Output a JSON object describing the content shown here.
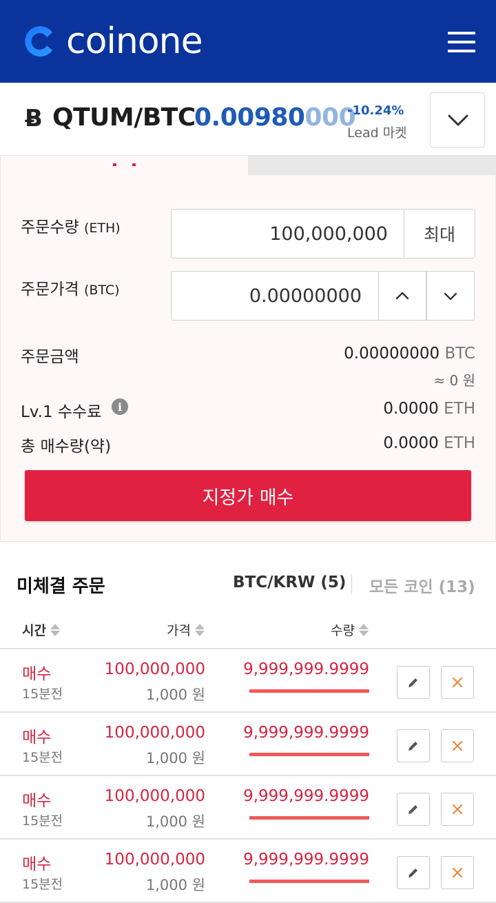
{
  "header": {
    "logo_text": "coinone",
    "brand_color": "#0a339c"
  },
  "market": {
    "coin_symbol": "Ƀ",
    "pair": "QTUM/BTC",
    "price_strong": "0.00980",
    "price_light": "000",
    "change": "-10.24%",
    "market_label": "Lead 마켓"
  },
  "order_form": {
    "qty_label": "주문수량",
    "qty_unit": "(ETH)",
    "qty_value": "100,000,000",
    "max_label": "최대",
    "price_label": "주문가격",
    "price_unit": "(BTC)",
    "price_value": "0.00000000",
    "amount_label": "주문금액",
    "amount_value": "0.00000000",
    "amount_unit": "BTC",
    "amount_krw": "≈ 0 원",
    "fee_label": "Lv.1 수수료",
    "fee_value": "0.0000",
    "fee_unit": "ETH",
    "total_label": "총 매수량(약)",
    "total_value": "0.0000",
    "total_unit": "ETH",
    "buy_button": "지정가 매수",
    "buy_color": "#e02141"
  },
  "open_orders": {
    "title": "미체결 주문",
    "tab_pair": "BTC/KRW (5)",
    "tab_all": "모든 코인  (13)",
    "col_time": "시간",
    "col_price": "가격",
    "col_qty": "수량",
    "rows": [
      {
        "side": "매수",
        "time": "15분전",
        "price": "100,000,000",
        "krw": "1,000 원",
        "qty": "9,999,999.9999"
      },
      {
        "side": "매수",
        "time": "15분전",
        "price": "100,000,000",
        "krw": "1,000 원",
        "qty": "9,999,999.9999"
      },
      {
        "side": "매수",
        "time": "15분전",
        "price": "100,000,000",
        "krw": "1,000 원",
        "qty": "9,999,999.9999"
      },
      {
        "side": "매수",
        "time": "15분전",
        "price": "100,000,000",
        "krw": "1,000 원",
        "qty": "9,999,999.9999"
      }
    ]
  }
}
